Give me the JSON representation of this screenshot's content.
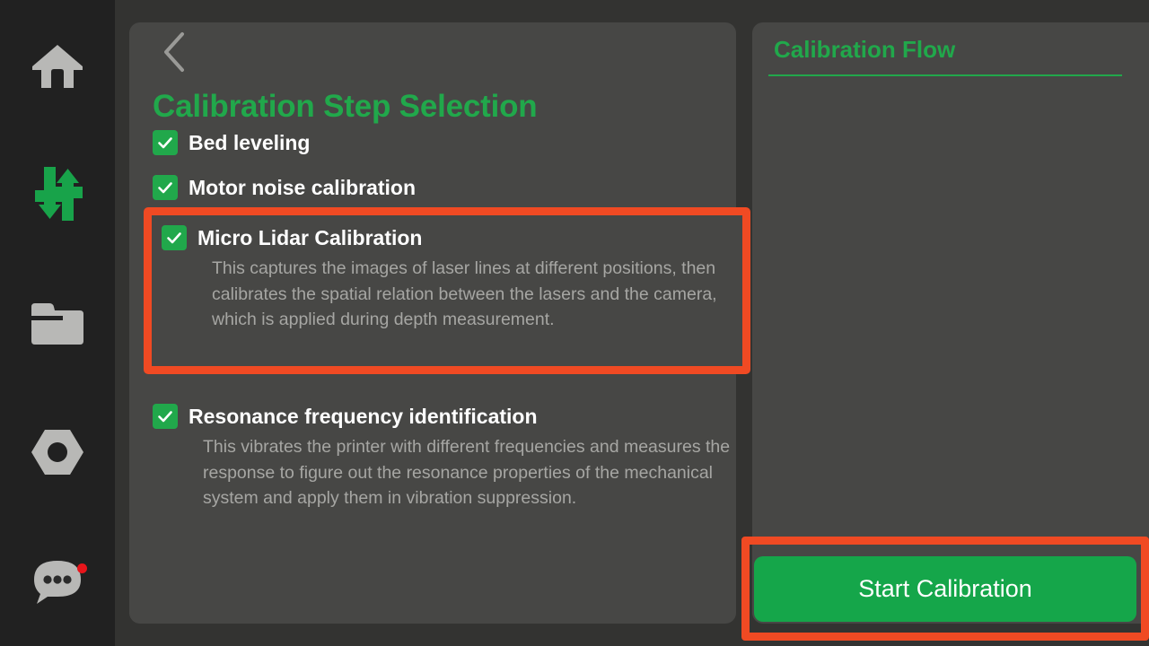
{
  "app": {
    "background_color": "#333331",
    "panel_color": "#474745",
    "accent_green": "#21A84B",
    "annotation_red": "#F04A23",
    "text_primary": "#FFFFFF",
    "text_secondary": "#A6A6A3"
  },
  "sidebar": {
    "items": [
      {
        "name": "home-icon",
        "label": "Home",
        "active": false
      },
      {
        "name": "controls-icon",
        "label": "Control",
        "active": true
      },
      {
        "name": "folder-icon",
        "label": "Files",
        "active": false
      },
      {
        "name": "nut-icon",
        "label": "Calibration",
        "active": false
      },
      {
        "name": "chat-icon",
        "label": "Messages",
        "active": false,
        "badge": true
      }
    ]
  },
  "left_panel": {
    "back_button": {
      "icon": "chevron-left-icon",
      "label": "Back"
    },
    "title": "Calibration Step Selection",
    "steps": [
      {
        "label": "Bed leveling",
        "checked": true,
        "description": ""
      },
      {
        "label": "Motor noise calibration",
        "checked": true,
        "description": ""
      },
      {
        "label": "Micro Lidar Calibration",
        "checked": true,
        "highlighted": true,
        "description": "This captures the images of laser lines at different positions, then calibrates the spatial relation between the lasers and the camera, which is applied during depth measurement."
      },
      {
        "label": "Resonance frequency identification",
        "checked": true,
        "description": "This vibrates the printer with different frequencies and measures the response to figure out the resonance properties of the mechanical system and apply them in vibration suppression."
      }
    ]
  },
  "right_panel": {
    "title": "Calibration Flow",
    "items": [],
    "start_button": {
      "label": "Start Calibration",
      "highlighted": true
    }
  }
}
